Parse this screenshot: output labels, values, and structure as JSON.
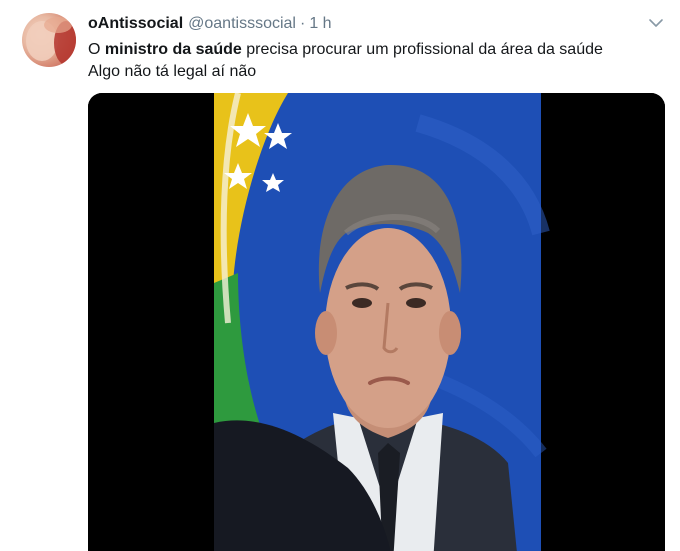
{
  "tweet": {
    "display_name": "oAntissocial",
    "handle": "@oantisssocial",
    "separator": "·",
    "time": "1 h",
    "text": {
      "line1_pre": "O ",
      "line1_bold": "ministro da saúde",
      "line1_post": " precisa procurar um profissional da área da saúde",
      "line2": "Algo não tá legal aí não"
    }
  },
  "icons": {
    "menu": "chevron-down-icon"
  },
  "colors": {
    "name": "#14171a",
    "meta": "#657786",
    "media_bg": "#000000",
    "flag_blue": "#1e4fb5",
    "flag_green": "#2e9a3e",
    "flag_yellow": "#e8c21a"
  }
}
